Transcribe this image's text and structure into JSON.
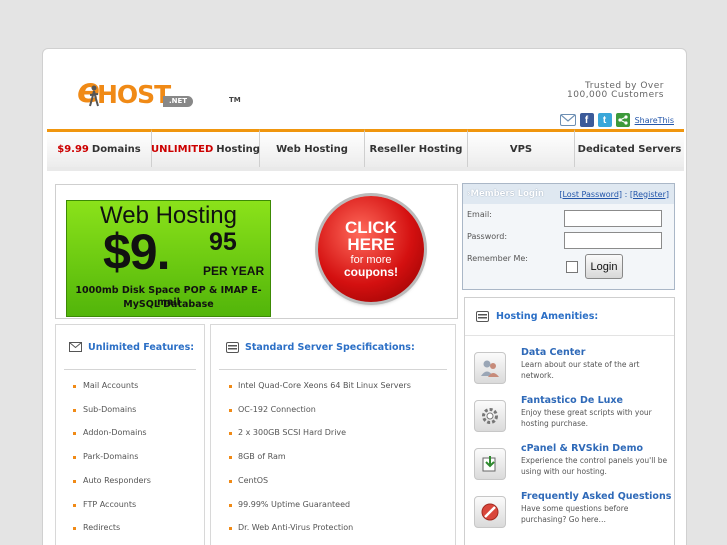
{
  "logo": {
    "e": "e",
    "host": "HOST",
    "net": ".NET",
    "tm": "TM"
  },
  "trusted": {
    "line1": "Trusted by Over",
    "line2": "100,000 Customers"
  },
  "share": {
    "label": "ShareThis"
  },
  "nav": [
    {
      "highlight": "$9.99",
      "label": "Domains"
    },
    {
      "highlight": "UNLIMITED",
      "label": "Hosting"
    },
    {
      "highlight": "",
      "label": "Web Hosting"
    },
    {
      "highlight": "",
      "label": "Reseller Hosting"
    },
    {
      "highlight": "",
      "label": "VPS"
    },
    {
      "highlight": "",
      "label": "Dedicated Servers"
    }
  ],
  "ad": {
    "title": "Web Hosting",
    "price": "$9.",
    "cents": "95",
    "per": "PER YEAR",
    "line1": "1000mb Disk Space  POP & IMAP E-mail",
    "line2": "MySQL Database"
  },
  "click": {
    "a": "CLICK",
    "a2": "HERE",
    "b": "for more",
    "c": "coupons!"
  },
  "login": {
    "title": "Members Login",
    "lost": "[Lost Password]",
    "sep": " : ",
    "register": "[Register]",
    "email_label": "Email:",
    "password_label": "Password:",
    "remember_label": "Remember Me:",
    "button": "Login"
  },
  "amenities": {
    "title": "Hosting Amenities:",
    "items": [
      {
        "title": "Data Center",
        "desc": "Learn about our state of the art network.",
        "icon": "users-icon"
      },
      {
        "title": "Fantastico De Luxe",
        "desc": "Enjoy these great scripts with your hosting purchase.",
        "icon": "gear-icon"
      },
      {
        "title": "cPanel & RVSkin Demo",
        "desc": "Experience the control panels you'll be using with our hosting.",
        "icon": "download-icon"
      },
      {
        "title": "Frequently Asked Questions",
        "desc": "Have some questions before purchasing? Go here…",
        "icon": "no-icon"
      }
    ]
  },
  "features": {
    "title": "Unlimited Features:",
    "items": [
      "Mail Accounts",
      "Sub-Domains",
      "Addon-Domains",
      "Park-Domains",
      "Auto Responders",
      "FTP Accounts",
      "Redirects"
    ]
  },
  "specs": {
    "title": "Standard Server Specifications:",
    "items": [
      "Intel Quad-Core Xeons 64 Bit Linux Servers",
      "OC-192 Connection",
      "2 x 300GB SCSI Hard Drive",
      "8GB of Ram",
      "CentOS",
      "99.99% Uptime Guaranteed",
      "Dr. Web Anti-Virus Protection"
    ]
  }
}
